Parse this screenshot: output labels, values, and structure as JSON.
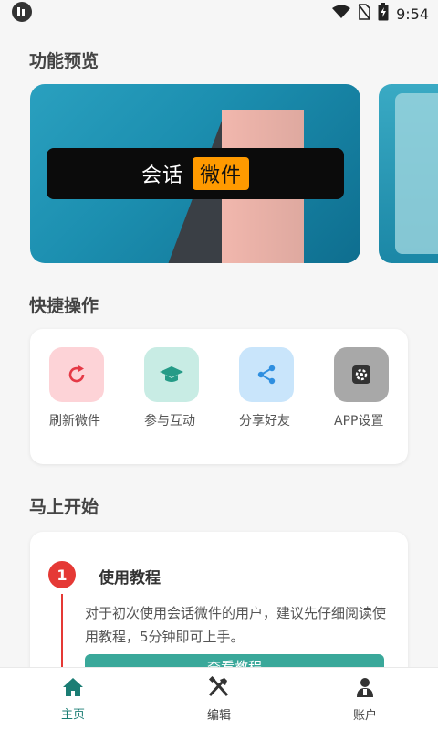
{
  "status_bar": {
    "time": "9:54"
  },
  "sections": {
    "preview_title": "功能预览",
    "quick_title": "快捷操作",
    "start_title": "马上开始"
  },
  "banner": {
    "word1": "会话",
    "word2": "微件"
  },
  "quick_actions": [
    {
      "label": "刷新微件",
      "icon": "refresh-icon",
      "bg": "#fdd3d7",
      "color": "#e53946"
    },
    {
      "label": "参与互动",
      "icon": "graduation-cap-icon",
      "bg": "#c8ece4",
      "color": "#259b87"
    },
    {
      "label": "分享好友",
      "icon": "share-icon",
      "bg": "#c9e5fb",
      "color": "#2f8fe0"
    },
    {
      "label": "APP设置",
      "icon": "settings-icon",
      "bg": "#a8a8a8",
      "color": "#333333"
    }
  ],
  "tutorial": {
    "step": "1",
    "title": "使用教程",
    "description": "对于初次使用会话微件的用户，建议先仔细阅读使用教程，5分钟即可上手。",
    "button": "查看教程"
  },
  "tabs": [
    {
      "label": "主页",
      "icon": "home-icon",
      "active": true
    },
    {
      "label": "编辑",
      "icon": "tools-icon",
      "active": false
    },
    {
      "label": "账户",
      "icon": "account-icon",
      "active": false
    }
  ],
  "colors": {
    "accent": "#1b7d74",
    "badge": "#e53935",
    "banner_highlight": "#ff9a00"
  }
}
